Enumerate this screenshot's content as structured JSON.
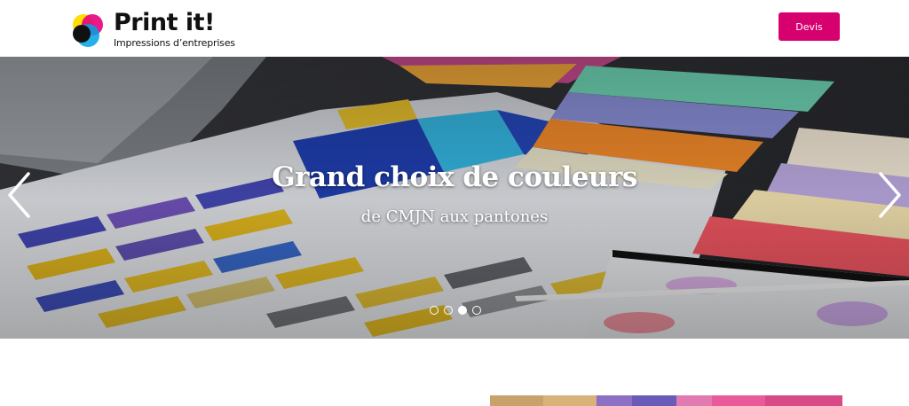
{
  "brand": {
    "name": "Print it!",
    "tagline": "Impressions d’entreprises",
    "colors": {
      "cyan": "#00a2e3",
      "magenta": "#e6007e",
      "yellow": "#ffde00",
      "black": "#111111"
    }
  },
  "header": {
    "cta_label": "Devis",
    "cta_color": "#d6006f"
  },
  "carousel": {
    "title": "Grand choix de couleurs",
    "subtitle": "de CMJN aux pantones",
    "prev_icon": "chevron-left-icon",
    "next_icon": "chevron-right-icon",
    "slide_count": 4,
    "active_index": 2
  }
}
